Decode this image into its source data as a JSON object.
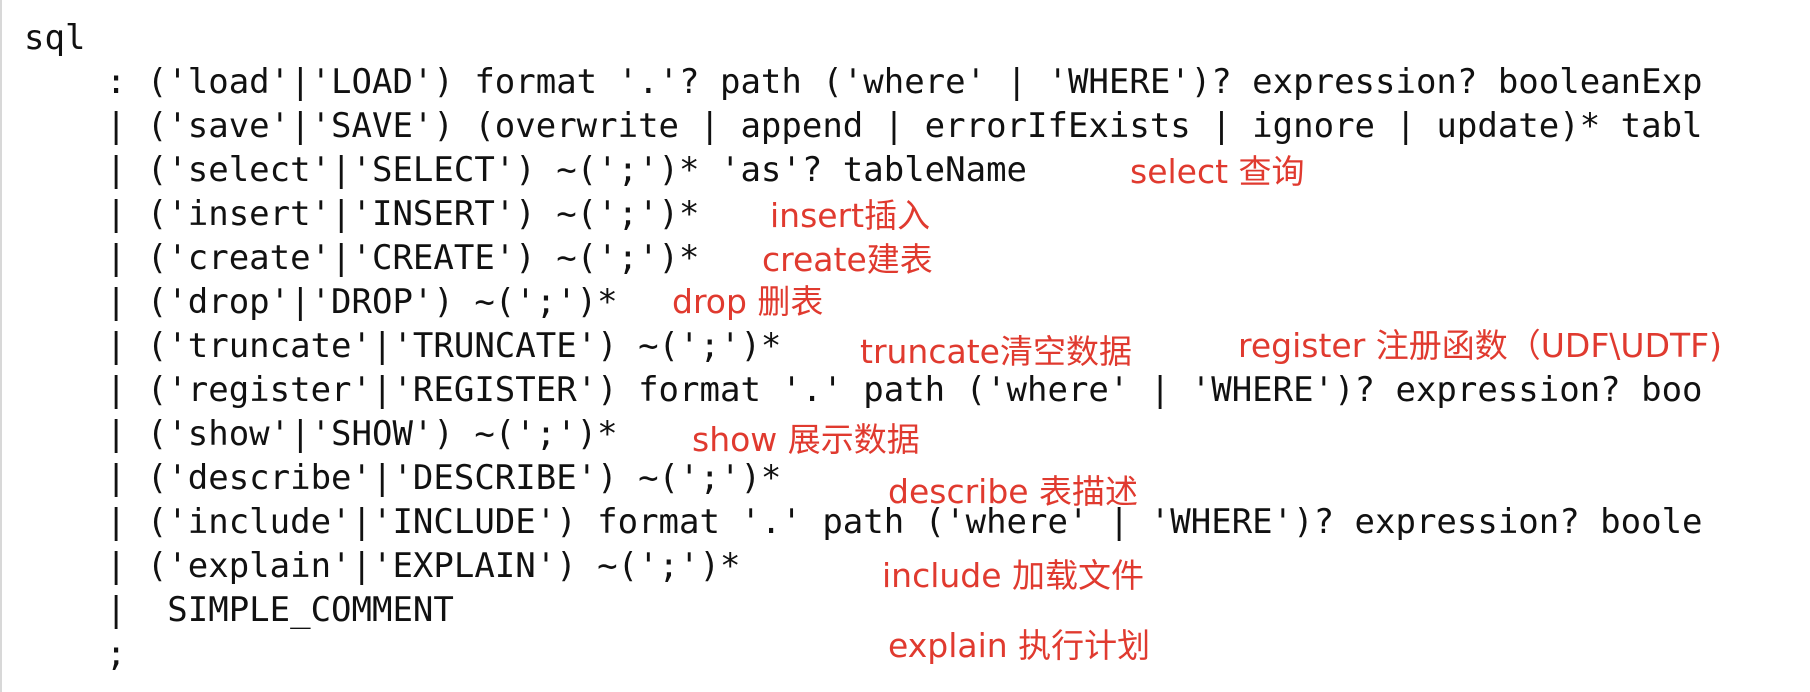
{
  "code": {
    "lines": [
      "sql",
      "    : ('load'|'LOAD') format '.'? path ('where' | 'WHERE')? expression? booleanExp",
      "    | ('save'|'SAVE') (overwrite | append | errorIfExists | ignore | update)* tabl",
      "    | ('select'|'SELECT') ~(';')* 'as'? tableName",
      "    | ('insert'|'INSERT') ~(';')*",
      "    | ('create'|'CREATE') ~(';')*",
      "    | ('drop'|'DROP') ~(';')*",
      "    | ('truncate'|'TRUNCATE') ~(';')*",
      "    | ('register'|'REGISTER') format '.' path ('where' | 'WHERE')? expression? boo",
      "    | ('show'|'SHOW') ~(';')*",
      "    | ('describe'|'DESCRIBE') ~(';')*",
      "    | ('include'|'INCLUDE') format '.' path ('where' | 'WHERE')? expression? boole",
      "    | ('explain'|'EXPLAIN') ~(';')*",
      "    |  SIMPLE_COMMENT",
      "    ;"
    ]
  },
  "annotations": {
    "select": "select 查询",
    "insert": "insert插入",
    "create": "create建表",
    "drop": "drop 删表",
    "truncate": "truncate清空数据",
    "register": "register 注册函数（UDF\\UDTF)",
    "show": "show 展示数据",
    "describe": "describe 表描述",
    "include": "include 加载文件",
    "explain": "explain  执行计划"
  },
  "colors": {
    "code_text": "#111111",
    "annotation": "#e03a2f",
    "background": "#ffffff"
  }
}
